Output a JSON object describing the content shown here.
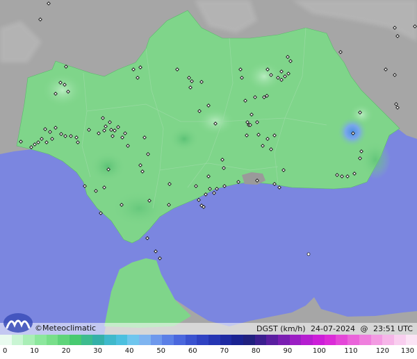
{
  "brand": {
    "copyright": "©",
    "name": "Meteoclimatic",
    "logo_icon": "meteoclimatic-logo-icon"
  },
  "stamp": {
    "variable": "DGST (km/h)",
    "date": "24-07-2024",
    "at": "@",
    "time": "23:51 UTC"
  },
  "colors": {
    "sea": "#7b86e0",
    "land_gray": "#a6a6a6",
    "land_green": "#7fd58a",
    "gust_spot_blue": "#6f9fe8",
    "station_marker": "#222222"
  },
  "legend": {
    "labels": [
      "0",
      "10",
      "20",
      "30",
      "40",
      "50",
      "60",
      "70",
      "80",
      "90",
      "100",
      "110",
      "120",
      "130"
    ],
    "colors": [
      "#e9fbef",
      "#c9f5d3",
      "#a9eeb6",
      "#8ce79d",
      "#78df8a",
      "#5fd47a",
      "#48ca70",
      "#3dbc8e",
      "#35b0a8",
      "#3fb9cb",
      "#4cc0df",
      "#6fc6ee",
      "#7fb4f0",
      "#6e98ec",
      "#5b7fe6",
      "#4a67dd",
      "#3a52cf",
      "#2f42c2",
      "#2535b3",
      "#1e2aa2",
      "#1a2291",
      "#20207f",
      "#3b1e8f",
      "#5a1ea0",
      "#7a1eb2",
      "#9b1ec4",
      "#b51dd0",
      "#cc1ed8",
      "#db2bd8",
      "#e447d8",
      "#ea63da",
      "#ef7fdd",
      "#f39be2",
      "#f6b5e8",
      "#f9ceef",
      "#fbe3f5"
    ]
  }
}
